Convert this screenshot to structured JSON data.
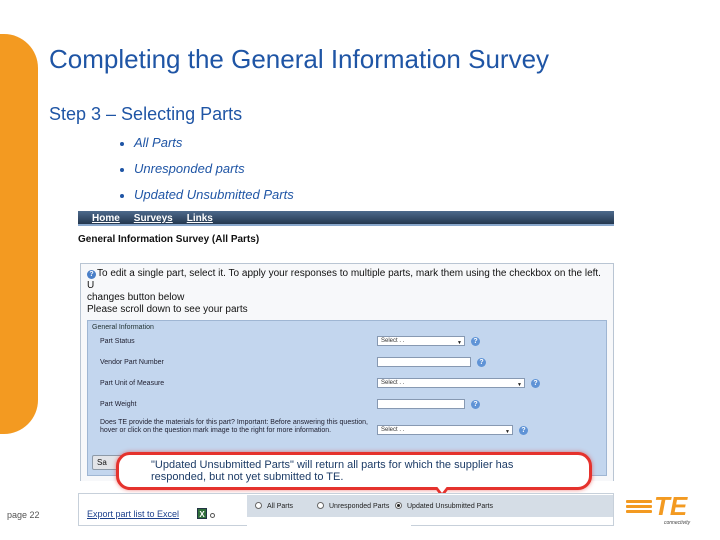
{
  "slide": {
    "title": "Completing the General Information Survey",
    "step": "Step 3 – Selecting Parts",
    "bullets": [
      "All Parts",
      "Unresponded parts",
      "Updated Unsubmitted Parts"
    ],
    "page_number": "page 22"
  },
  "screenshot": {
    "nav": [
      "Home",
      "Surveys",
      "Links"
    ],
    "title": "General Information Survey (All Parts)",
    "instructions": [
      "To edit a single part, select it. To apply your responses to multiple parts, mark them using the checkbox on the left. U",
      "changes button below",
      "Please scroll down to see your parts"
    ],
    "form": {
      "heading": "General Information",
      "rows": [
        {
          "label": "Part Status",
          "value": "Select . ."
        },
        {
          "label": "Vendor Part Number",
          "value": ""
        },
        {
          "label": "Part Unit of Measure",
          "value": "Select . ."
        },
        {
          "label": "Part Weight",
          "value": ""
        },
        {
          "label": "Does TE provide the materials for this part? Important: Before answering this question, hover or click on the question mark image to the right for more information.",
          "value": "Select . ."
        }
      ],
      "help_icon": "question-icon"
    },
    "save_button": "Sa",
    "export_link": "Export part list to Excel",
    "radios": [
      {
        "label": "All Parts",
        "checked": false
      },
      {
        "label": "Unresponded Parts",
        "checked": false
      },
      {
        "label": "Updated Unsubmitted Parts",
        "checked": true
      }
    ]
  },
  "callout": {
    "line1": "\"Updated Unsubmitted Parts\" will return all parts for which the supplier has",
    "line2": "responded, but not yet submitted to TE."
  },
  "logo": {
    "text": "TE",
    "sub": "connectivity"
  },
  "colors": {
    "accent_orange": "#f39a21",
    "title_blue": "#1f55a5",
    "callout_red": "#e5322d",
    "form_blue": "#c3d6ee"
  }
}
